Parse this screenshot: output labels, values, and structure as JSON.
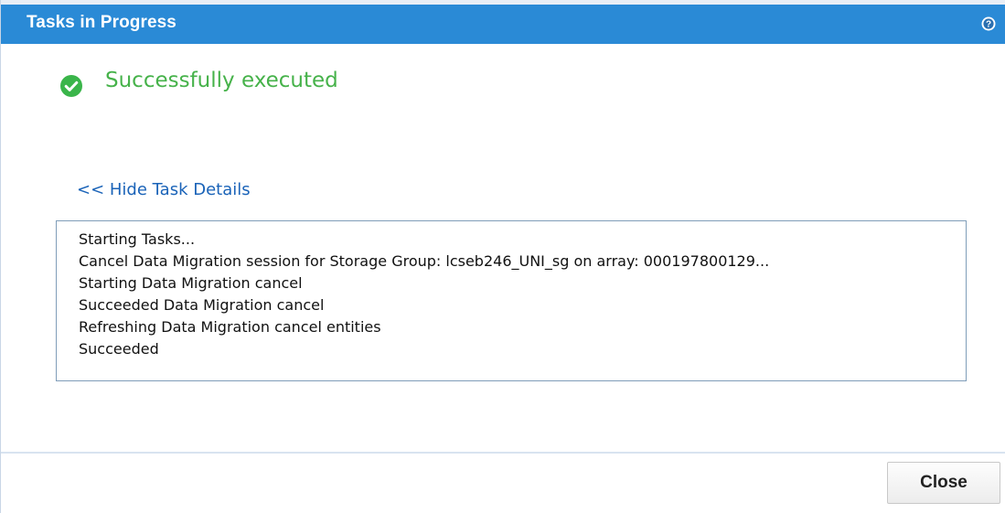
{
  "window": {
    "title": "Tasks in Progress",
    "help_icon": "help-icon",
    "titlebar_color": "#2a8ad6"
  },
  "status": {
    "icon": "check-circle-icon",
    "text": "Successfully executed",
    "color": "#46b24a"
  },
  "details_link": {
    "label": "<< Hide Task Details",
    "color": "#1a63b8"
  },
  "task_log": {
    "lines": [
      "Starting Tasks...",
      "Cancel Data Migration session for Storage Group: lcseb246_UNI_sg on array: 000197800129...",
      "Starting Data Migration cancel",
      "Succeeded Data Migration cancel",
      "Refreshing Data Migration cancel entities",
      "Succeeded"
    ]
  },
  "footer": {
    "close_label": "Close"
  }
}
